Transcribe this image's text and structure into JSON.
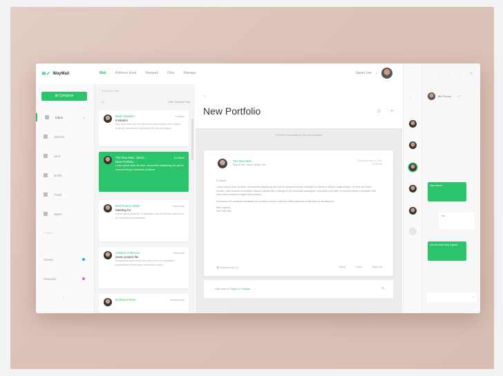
{
  "app": {
    "logo": "WayMail",
    "nav": [
      "Mail",
      "Address book",
      "Notepad",
      "Files",
      "Manage"
    ],
    "active_nav": "Mail",
    "user_name": "Jason Lee"
  },
  "sidebar": {
    "compose_label": "Compose",
    "items": [
      {
        "label": "Inbox",
        "count": "4"
      },
      {
        "label": "Starred",
        "count": ""
      },
      {
        "label": "Sent",
        "count": ""
      },
      {
        "label": "Drafts",
        "count": ""
      },
      {
        "label": "Trash",
        "count": ""
      },
      {
        "label": "Spam",
        "count": ""
      }
    ],
    "labels_heading": "LABELS",
    "labels": [
      {
        "label": "Clients",
        "color": "#29a3e6"
      },
      {
        "label": "Personal",
        "color": "#d463e6"
      }
    ]
  },
  "list": {
    "search_placeholder": "Search mail",
    "sort_label": "Sort: Newest First",
    "cards": [
      {
        "from": "Brett Hawkins",
        "time": "9:40am",
        "subject": "Invitation",
        "preview": "Hey, how have you are find some about those Lorem ipsum dolor sit, consectetur adipiscing elit, sed do magna."
      },
      {
        "from": "The Ras Man, Jason…",
        "time": "10:45am",
        "subject": "New Portfolio",
        "preview": "Lorem ipsum dolor sit amet, consectetur adipiscing elit, sed do eiusmod tempor incididunt ut labore."
      },
      {
        "from": "Berl Roslon Shell",
        "time": "Yesterday",
        "subject": "Meeting for",
        "preview": "Lorem ipsum dolor sit. Perspiciatis unde omnis iste natus error sit voluptatem accusantium."
      },
      {
        "from": "Antoine Anderson",
        "time": "Yesterday",
        "subject": "Some project file",
        "preview": "Perspiciatis unde omnis iste natus error sit voluptatem accusantium doloremque laudantium totam."
      },
      {
        "from": "Ruthania Ross",
        "time": "Wednesday",
        "subject": "",
        "preview": ""
      }
    ]
  },
  "pane": {
    "title": "New Portfolio",
    "notice": "4 Further Messages in this conversation",
    "mail": {
      "from": "The Ras Man",
      "meta": "Ras to me, Jason Smith, Mo",
      "date": "Thursday, Nov 8, 2016",
      "time": "10:45 AM",
      "greeting": "Hi Jason,",
      "para1": "Lorem ipsum dolor sit amet, consectetur adipiscing elit, sed do eiusmod tempor incididunt ut labore et dolore magna aliqua. Ut enim ad minim veniam, quis nostrud exercitation ullamco laboris nisi ut aliquip ex ea commodo consequat. Duis aute irure dolor in reprehenderit in voluptate velit esse cillum dolore eu fugiat nulla pariatur.",
      "para2": "Excepteur sint occaecat cupidatat non proident, sunt in culpa qui officia deserunt mollit anim id est laborum.",
      "signoff": "Best regards,",
      "signature": "The Ras Man",
      "attachment": "Attachments (2)",
      "actions": [
        "Reply",
        "Share",
        "Reply all"
      ]
    },
    "reply_prefix": "Click here to",
    "reply_link1": "Reply",
    "reply_mid": "or",
    "reply_link2": "Forward"
  },
  "chat": {
    "name": "Mo Florian",
    "messages": [
      {
        "text": "Hey Jason!",
        "mine": false
      },
      {
        "text": "Hey",
        "mine": true
      },
      {
        "text": "Let me know how it goes!",
        "mine": false
      }
    ]
  },
  "colors": {
    "accent": "#2bc46b"
  }
}
